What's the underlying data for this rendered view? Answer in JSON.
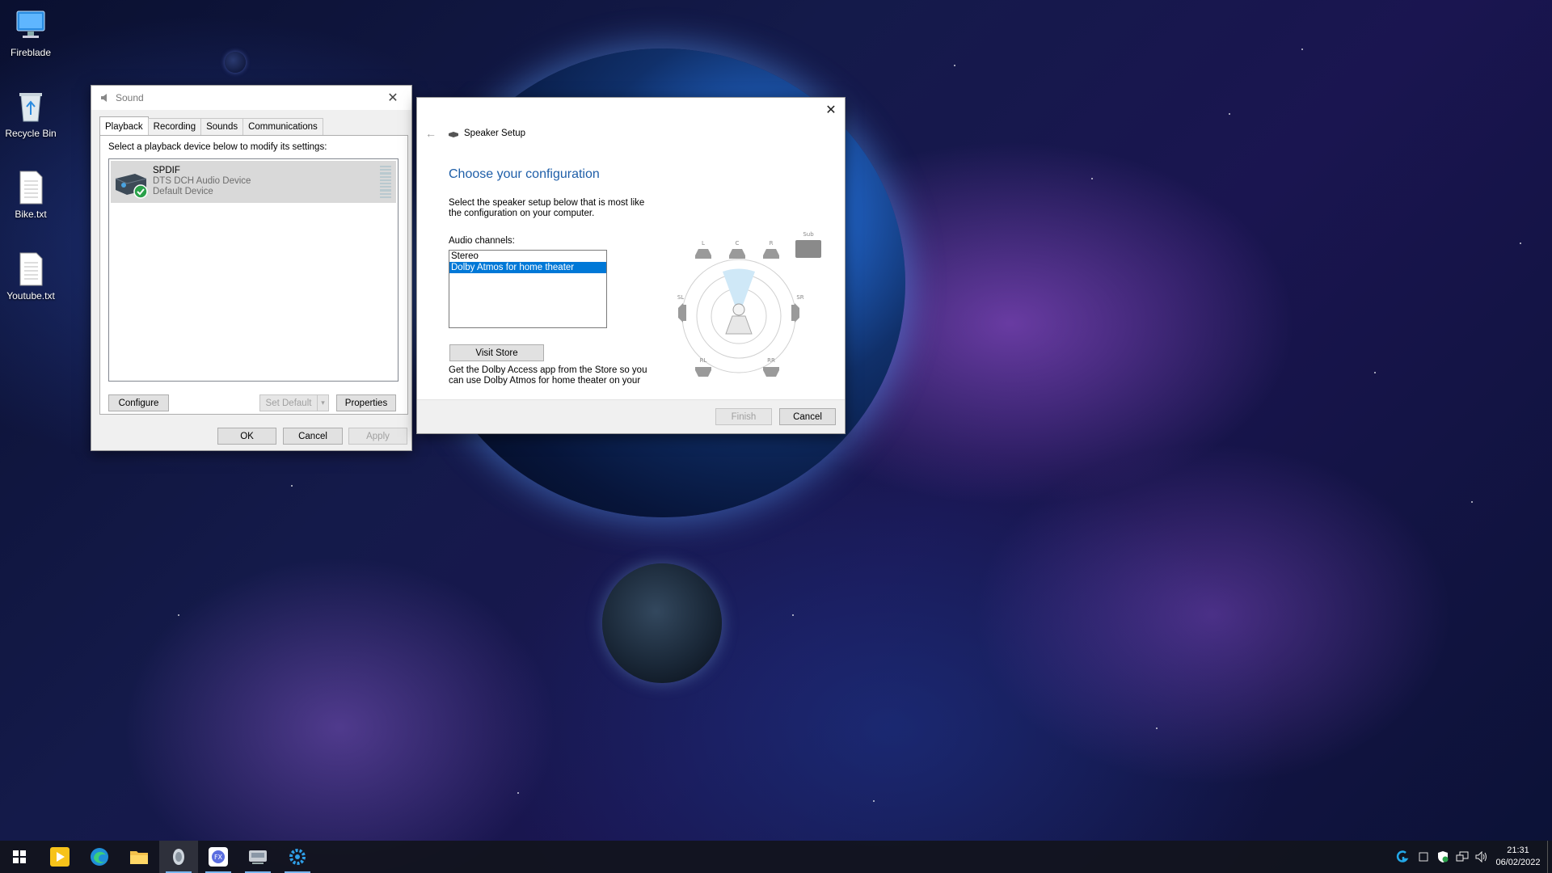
{
  "desktop": {
    "icons": [
      {
        "label": "Fireblade",
        "icon": "monitor-icon"
      },
      {
        "label": "Recycle Bin",
        "icon": "recycle-bin-icon"
      },
      {
        "label": "Bike.txt",
        "icon": "text-file-icon"
      },
      {
        "label": "Youtube.txt",
        "icon": "text-file-icon"
      }
    ]
  },
  "sound_dialog": {
    "title": "Sound",
    "tabs": [
      "Playback",
      "Recording",
      "Sounds",
      "Communications"
    ],
    "active_tab": "Playback",
    "instruction": "Select a playback device below to modify its settings:",
    "device": {
      "name": "SPDIF",
      "description": "DTS DCH Audio Device",
      "status": "Default Device"
    },
    "buttons": {
      "configure": "Configure",
      "set_default": "Set Default",
      "properties": "Properties",
      "ok": "OK",
      "cancel": "Cancel",
      "apply": "Apply"
    }
  },
  "speaker_setup": {
    "title": "Speaker Setup",
    "heading": "Choose your configuration",
    "instruction": "Select the speaker setup below that is most like the configuration on your computer.",
    "channels_label": "Audio channels:",
    "channels": [
      "Stereo",
      "Dolby Atmos for home theater"
    ],
    "selected_channel": "Dolby Atmos for home theater",
    "visit_store": "Visit Store",
    "store_text": "Get the Dolby Access app from the Store so you can use Dolby Atmos for home theater on your",
    "speaker_labels": {
      "left": "L",
      "center": "C",
      "right": "R",
      "sub": "Sub",
      "side_left": "SL",
      "side_right": "SR",
      "rear_left": "RL",
      "rear_right": "RR"
    },
    "buttons": {
      "finish": "Finish",
      "cancel": "Cancel"
    }
  },
  "taskbar": {
    "apps": [
      "start-icon",
      "player-icon",
      "edge-icon",
      "file-explorer-icon",
      "sound-app-icon",
      "media-app-icon",
      "drive-app-icon",
      "settings-app-icon"
    ],
    "time": "21:31",
    "date": "06/02/2022"
  },
  "colors": {
    "accent": "#0078d7",
    "heading_blue": "#1e5ea8",
    "taskbar": "#12141e"
  }
}
